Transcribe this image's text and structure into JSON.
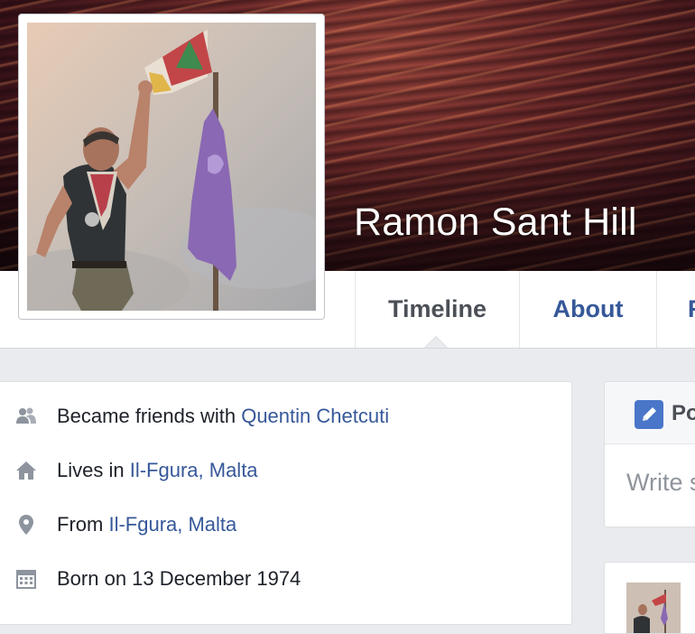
{
  "profile": {
    "name": "Ramon Sant Hill"
  },
  "nav": {
    "tabs": [
      {
        "label": "Timeline",
        "active": true
      },
      {
        "label": "About"
      },
      {
        "label": "F"
      }
    ]
  },
  "intro": {
    "items": [
      {
        "icon": "friends-icon",
        "prefix": "Became friends with ",
        "link": "Quentin Chetcuti"
      },
      {
        "icon": "home-icon",
        "prefix": "Lives in ",
        "link": "Il-Fgura, Malta"
      },
      {
        "icon": "location-pin-icon",
        "prefix": "From ",
        "link": "Il-Fgura, Malta"
      },
      {
        "icon": "calendar-icon",
        "prefix": "Born on 13 December 1974",
        "link": ""
      }
    ]
  },
  "composer": {
    "label": "Po",
    "placeholder": "Write s"
  },
  "colors": {
    "link": "#365899",
    "text": "#1d2129",
    "background": "#e9ebee",
    "accent": "#4a76c9"
  }
}
